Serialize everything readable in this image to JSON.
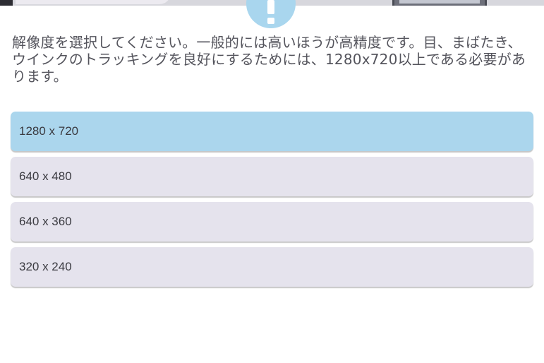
{
  "dialog": {
    "description": "解像度を選択してください。一般的には高いほうが高精度です。目、まばたき、ウインクのトラッキングを良好にするためには、1280x720以上である必要があります。",
    "selected_index": 0,
    "options": [
      {
        "label": "1280 x 720"
      },
      {
        "label": "640 x 480"
      },
      {
        "label": "640 x 360"
      },
      {
        "label": "320 x 240"
      }
    ]
  },
  "icons": {
    "alert": "exclamation-icon"
  },
  "colors": {
    "selected_option": "#abd6ed",
    "option": "#e5e3ed",
    "alert_circle": "#a9d6ee",
    "text": "#54545c"
  }
}
